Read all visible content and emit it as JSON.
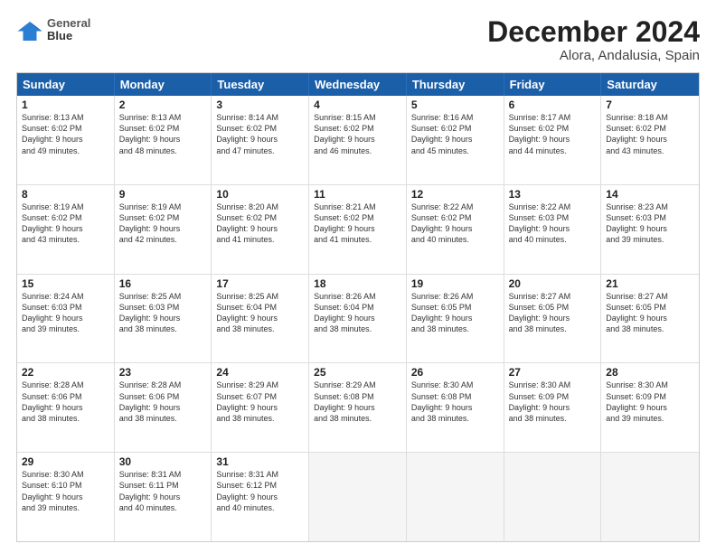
{
  "header": {
    "logo": {
      "line1": "General",
      "line2": "Blue"
    },
    "month": "December 2024",
    "location": "Alora, Andalusia, Spain"
  },
  "days": [
    "Sunday",
    "Monday",
    "Tuesday",
    "Wednesday",
    "Thursday",
    "Friday",
    "Saturday"
  ],
  "rows": [
    [
      {
        "day": "",
        "empty": true
      },
      {
        "day": "",
        "empty": true
      },
      {
        "day": "",
        "empty": true
      },
      {
        "day": "",
        "empty": true
      },
      {
        "day": "",
        "empty": true
      },
      {
        "day": "",
        "empty": true
      },
      {
        "day": "",
        "empty": true
      }
    ],
    [
      {
        "num": "1",
        "lines": [
          "Sunrise: 8:13 AM",
          "Sunset: 6:02 PM",
          "Daylight: 9 hours",
          "and 49 minutes."
        ]
      },
      {
        "num": "2",
        "lines": [
          "Sunrise: 8:13 AM",
          "Sunset: 6:02 PM",
          "Daylight: 9 hours",
          "and 48 minutes."
        ]
      },
      {
        "num": "3",
        "lines": [
          "Sunrise: 8:14 AM",
          "Sunset: 6:02 PM",
          "Daylight: 9 hours",
          "and 47 minutes."
        ]
      },
      {
        "num": "4",
        "lines": [
          "Sunrise: 8:15 AM",
          "Sunset: 6:02 PM",
          "Daylight: 9 hours",
          "and 46 minutes."
        ]
      },
      {
        "num": "5",
        "lines": [
          "Sunrise: 8:16 AM",
          "Sunset: 6:02 PM",
          "Daylight: 9 hours",
          "and 45 minutes."
        ]
      },
      {
        "num": "6",
        "lines": [
          "Sunrise: 8:17 AM",
          "Sunset: 6:02 PM",
          "Daylight: 9 hours",
          "and 44 minutes."
        ]
      },
      {
        "num": "7",
        "lines": [
          "Sunrise: 8:18 AM",
          "Sunset: 6:02 PM",
          "Daylight: 9 hours",
          "and 43 minutes."
        ]
      }
    ],
    [
      {
        "num": "8",
        "lines": [
          "Sunrise: 8:19 AM",
          "Sunset: 6:02 PM",
          "Daylight: 9 hours",
          "and 43 minutes."
        ]
      },
      {
        "num": "9",
        "lines": [
          "Sunrise: 8:19 AM",
          "Sunset: 6:02 PM",
          "Daylight: 9 hours",
          "and 42 minutes."
        ]
      },
      {
        "num": "10",
        "lines": [
          "Sunrise: 8:20 AM",
          "Sunset: 6:02 PM",
          "Daylight: 9 hours",
          "and 41 minutes."
        ]
      },
      {
        "num": "11",
        "lines": [
          "Sunrise: 8:21 AM",
          "Sunset: 6:02 PM",
          "Daylight: 9 hours",
          "and 41 minutes."
        ]
      },
      {
        "num": "12",
        "lines": [
          "Sunrise: 8:22 AM",
          "Sunset: 6:02 PM",
          "Daylight: 9 hours",
          "and 40 minutes."
        ]
      },
      {
        "num": "13",
        "lines": [
          "Sunrise: 8:22 AM",
          "Sunset: 6:03 PM",
          "Daylight: 9 hours",
          "and 40 minutes."
        ]
      },
      {
        "num": "14",
        "lines": [
          "Sunrise: 8:23 AM",
          "Sunset: 6:03 PM",
          "Daylight: 9 hours",
          "and 39 minutes."
        ]
      }
    ],
    [
      {
        "num": "15",
        "lines": [
          "Sunrise: 8:24 AM",
          "Sunset: 6:03 PM",
          "Daylight: 9 hours",
          "and 39 minutes."
        ]
      },
      {
        "num": "16",
        "lines": [
          "Sunrise: 8:25 AM",
          "Sunset: 6:03 PM",
          "Daylight: 9 hours",
          "and 38 minutes."
        ]
      },
      {
        "num": "17",
        "lines": [
          "Sunrise: 8:25 AM",
          "Sunset: 6:04 PM",
          "Daylight: 9 hours",
          "and 38 minutes."
        ]
      },
      {
        "num": "18",
        "lines": [
          "Sunrise: 8:26 AM",
          "Sunset: 6:04 PM",
          "Daylight: 9 hours",
          "and 38 minutes."
        ]
      },
      {
        "num": "19",
        "lines": [
          "Sunrise: 8:26 AM",
          "Sunset: 6:05 PM",
          "Daylight: 9 hours",
          "and 38 minutes."
        ]
      },
      {
        "num": "20",
        "lines": [
          "Sunrise: 8:27 AM",
          "Sunset: 6:05 PM",
          "Daylight: 9 hours",
          "and 38 minutes."
        ]
      },
      {
        "num": "21",
        "lines": [
          "Sunrise: 8:27 AM",
          "Sunset: 6:05 PM",
          "Daylight: 9 hours",
          "and 38 minutes."
        ]
      }
    ],
    [
      {
        "num": "22",
        "lines": [
          "Sunrise: 8:28 AM",
          "Sunset: 6:06 PM",
          "Daylight: 9 hours",
          "and 38 minutes."
        ]
      },
      {
        "num": "23",
        "lines": [
          "Sunrise: 8:28 AM",
          "Sunset: 6:06 PM",
          "Daylight: 9 hours",
          "and 38 minutes."
        ]
      },
      {
        "num": "24",
        "lines": [
          "Sunrise: 8:29 AM",
          "Sunset: 6:07 PM",
          "Daylight: 9 hours",
          "and 38 minutes."
        ]
      },
      {
        "num": "25",
        "lines": [
          "Sunrise: 8:29 AM",
          "Sunset: 6:08 PM",
          "Daylight: 9 hours",
          "and 38 minutes."
        ]
      },
      {
        "num": "26",
        "lines": [
          "Sunrise: 8:30 AM",
          "Sunset: 6:08 PM",
          "Daylight: 9 hours",
          "and 38 minutes."
        ]
      },
      {
        "num": "27",
        "lines": [
          "Sunrise: 8:30 AM",
          "Sunset: 6:09 PM",
          "Daylight: 9 hours",
          "and 38 minutes."
        ]
      },
      {
        "num": "28",
        "lines": [
          "Sunrise: 8:30 AM",
          "Sunset: 6:09 PM",
          "Daylight: 9 hours",
          "and 39 minutes."
        ]
      }
    ],
    [
      {
        "num": "29",
        "lines": [
          "Sunrise: 8:30 AM",
          "Sunset: 6:10 PM",
          "Daylight: 9 hours",
          "and 39 minutes."
        ]
      },
      {
        "num": "30",
        "lines": [
          "Sunrise: 8:31 AM",
          "Sunset: 6:11 PM",
          "Daylight: 9 hours",
          "and 40 minutes."
        ]
      },
      {
        "num": "31",
        "lines": [
          "Sunrise: 8:31 AM",
          "Sunset: 6:12 PM",
          "Daylight: 9 hours",
          "and 40 minutes."
        ]
      },
      {
        "empty": true
      },
      {
        "empty": true
      },
      {
        "empty": true
      },
      {
        "empty": true
      }
    ]
  ]
}
